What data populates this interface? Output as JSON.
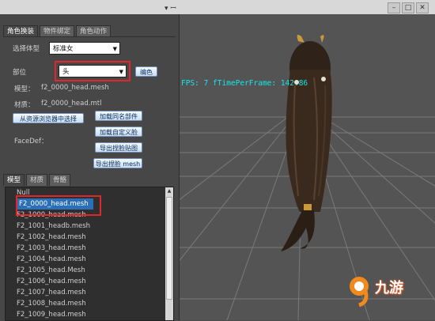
{
  "window": {
    "pin_icon": "pin-icon",
    "minimize": "–",
    "maximize": "□",
    "close": "✕"
  },
  "tabs": [
    "角色换装",
    "物件绑定",
    "角色动作"
  ],
  "form": {
    "body_type_label": "选择体型",
    "body_type_value": "标准女",
    "part_label": "部位",
    "part_value": "头",
    "edit_button": "编色",
    "model_label": "模型：",
    "model_value": "f2_0000_head.mesh",
    "material_label": "材质：",
    "material_value": "f2_0000_head.mtl",
    "browse_button": "从资源浏览器中选择",
    "load_same_name_button": "加载同名部件",
    "load_custom_face_button": "加载自定义脸",
    "facedef_label": "FaceDef：",
    "export_face_map_button": "导出捏脸贴图",
    "export_face_mesh_button": "导出捏脸 mesh"
  },
  "subtabs": [
    "模型",
    "材质",
    "骨骼"
  ],
  "list": {
    "items": [
      "Null",
      "F2_0000_head.mesh",
      "F2_1000_head.mesh",
      "F2_1001_headb.mesh",
      "F2_1002_head.mesh",
      "F2_1003_head.mesh",
      "F2_1004_head.mesh",
      "F2_1005_head.Mesh",
      "F2_1006_head.mesh",
      "F2_1007_head.mesh",
      "F2_1008_head.mesh",
      "F2_1009_head.mesh"
    ],
    "selected_index": 1
  },
  "viewport": {
    "fps_text": "FPS: 7 fTimePerFrame: 142.86"
  },
  "watermark": {
    "text": "九游"
  },
  "colors": {
    "highlight_red": "#e3262b",
    "selection_blue": "#2a6fb8",
    "fps_cyan": "#14e8e8"
  }
}
